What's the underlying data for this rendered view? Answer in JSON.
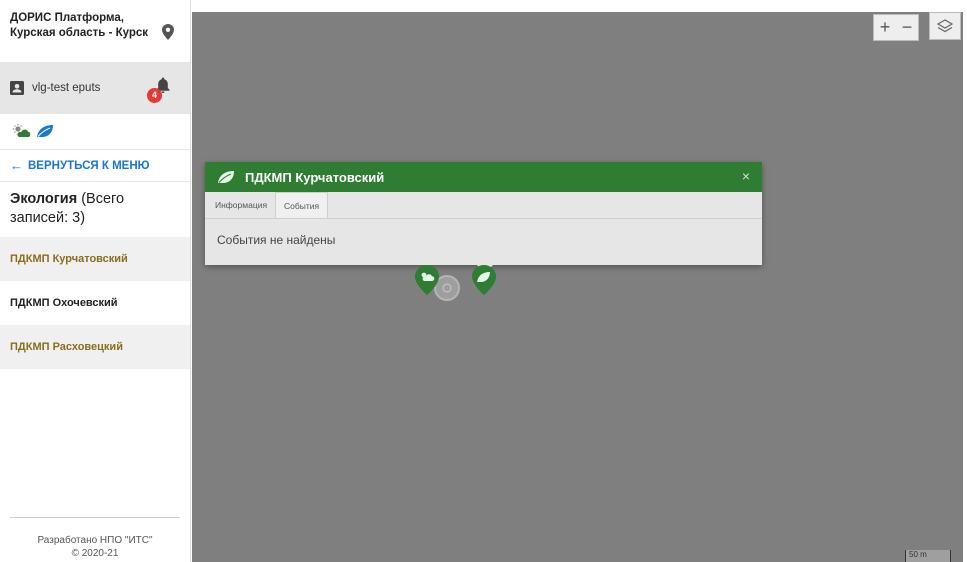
{
  "sidebar": {
    "brand_line1": "ДОРИС Платформа,",
    "brand_line2": "Курская область - Курск",
    "user_name": "vlg-test eputs",
    "notification_count": "4",
    "back_label": "ВЕРНУТЬСЯ К МЕНЮ",
    "back_arrow": "←",
    "section_title_bold": "Экология",
    "section_title_rest": " (Всего записей: 3)",
    "items": [
      {
        "label": "ПДКМП Курчатовский"
      },
      {
        "label": "ПДКМП Охочевский"
      },
      {
        "label": "ПДКМП Расховецкий"
      }
    ],
    "footer_line1": "Разработано НПО \"ИТС\"",
    "footer_line2": "© 2020-21"
  },
  "map": {
    "zoom_in": "+",
    "zoom_out": "−",
    "scale_label": "50 m"
  },
  "popup": {
    "title": "ПДКМП Курчатовский",
    "close": "×",
    "tabs": [
      "Информация",
      "События"
    ],
    "active_tab": "События",
    "body_text": "События не найдены"
  },
  "colors": {
    "accent_green": "#2e7d32",
    "link_blue": "#1976d2",
    "badge_red": "#e53935",
    "highlight_text": "#8a6d1f",
    "map_overlay": "#7f7f7f"
  },
  "icons": {
    "location": "map-pin-icon",
    "user": "account-box-icon",
    "bell": "bell-icon",
    "weather": "weather-icon",
    "leaf": "leaf-icon",
    "layers": "layers-icon"
  }
}
